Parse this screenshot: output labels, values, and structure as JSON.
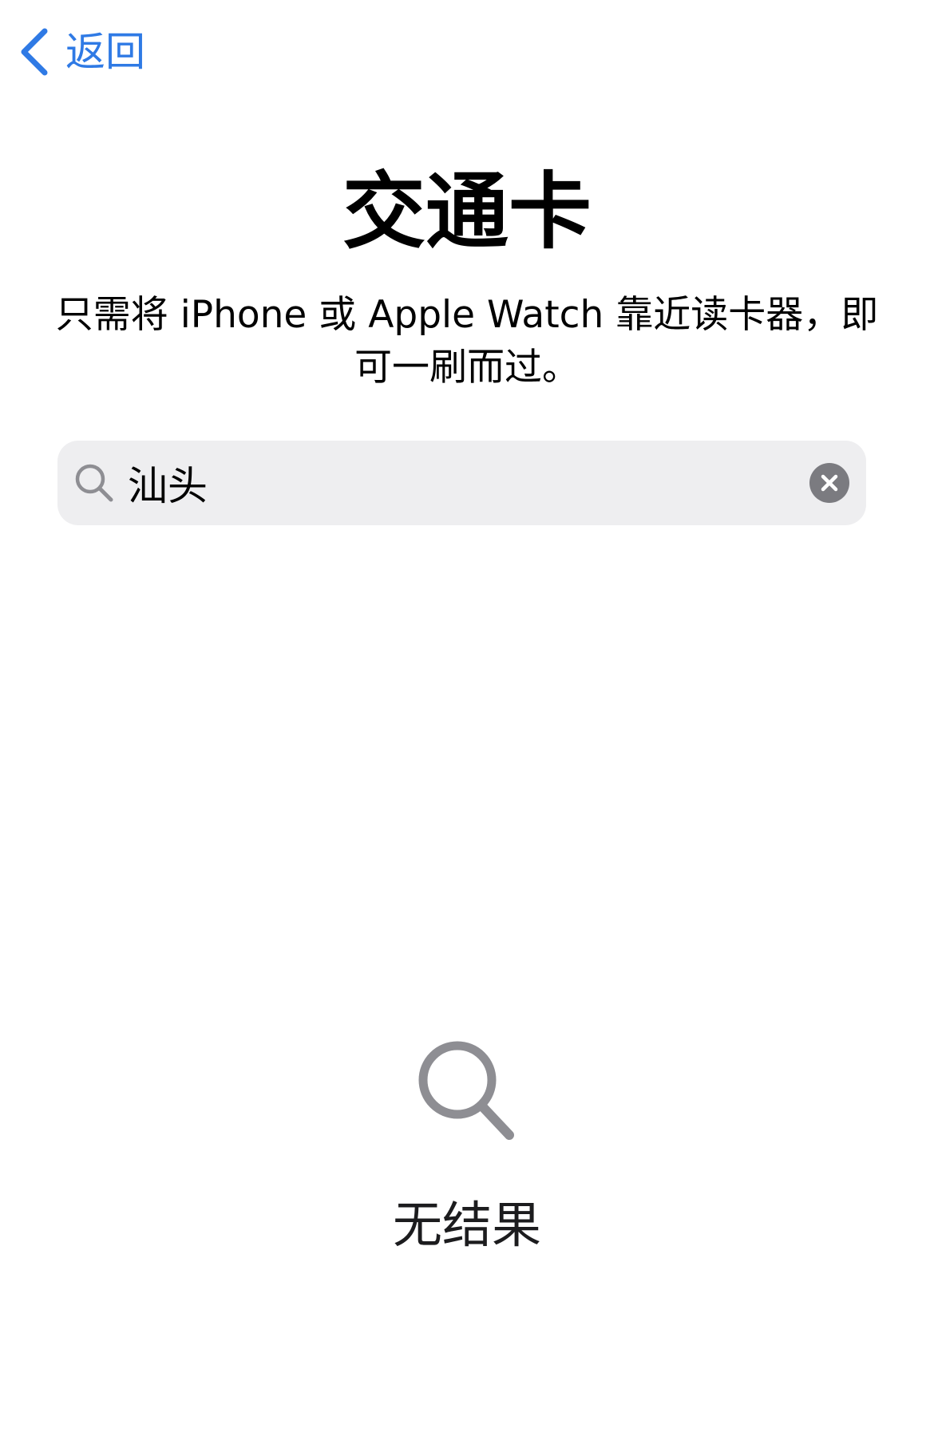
{
  "nav": {
    "back_label": "返回",
    "accent_color": "#2f7ae5"
  },
  "header": {
    "title": "交通卡",
    "subtitle": "只需将 iPhone 或 Apple Watch 靠近读卡器，即可一刷而过。"
  },
  "search": {
    "value": "汕头",
    "icon": "search-icon",
    "clear_icon": "clear-icon"
  },
  "empty_state": {
    "icon": "search-icon",
    "message": "无结果"
  }
}
